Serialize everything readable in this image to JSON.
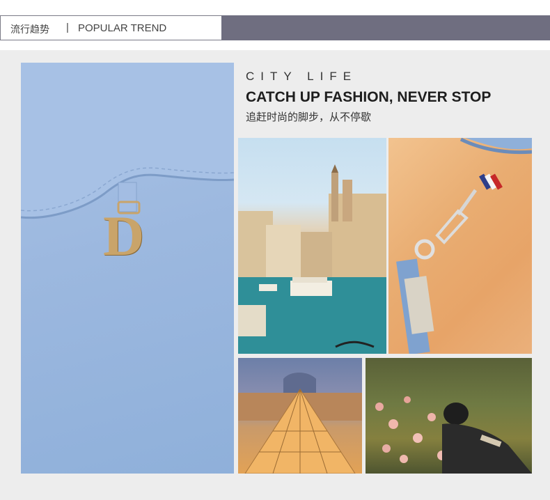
{
  "header": {
    "zh_title": "流行趋势",
    "separator": "|",
    "en_title": "POPULAR TREND",
    "bar_color": "#6f6e80"
  },
  "content": {
    "city_life": "CITY LIFE",
    "headline": "CATCH UP FASHION, NEVER STOP",
    "zh_subtitle": "追赶时尚的脚步，从不停歇"
  },
  "product": {
    "logo_letter": "D",
    "leather_color": "#9cb8df",
    "hardware_color": "#c9a46a"
  },
  "photos": [
    {
      "name": "venice-canal-photo"
    },
    {
      "name": "strap-clasp-photo"
    },
    {
      "name": "louvre-pyramid-photo"
    },
    {
      "name": "rose-garden-photo"
    }
  ]
}
